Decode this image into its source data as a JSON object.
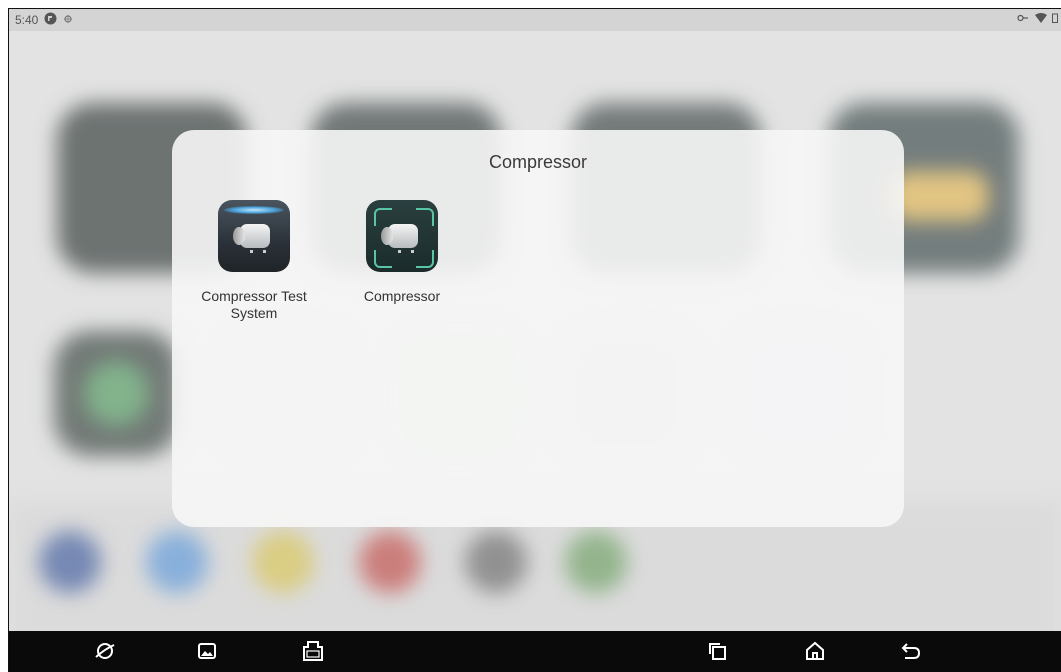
{
  "status_bar": {
    "time": "5:40"
  },
  "folder": {
    "title": "Compressor",
    "apps": [
      {
        "label": "Compressor Test System",
        "icon": "compressor-test-system-icon"
      },
      {
        "label": "Compressor",
        "icon": "compressor-icon"
      }
    ]
  },
  "nav_bar": {
    "left_buttons": [
      "browser-icon",
      "gallery-icon",
      "vci-icon"
    ],
    "right_buttons": [
      "recent-apps-icon",
      "home-icon",
      "back-icon"
    ]
  }
}
